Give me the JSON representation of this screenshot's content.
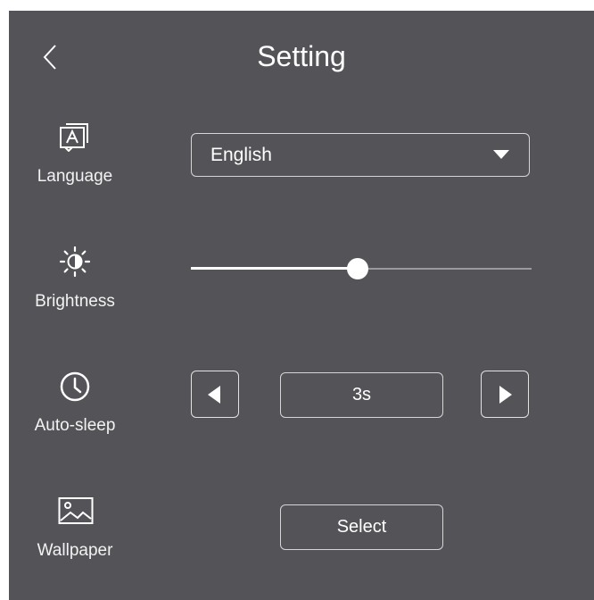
{
  "header": {
    "title": "Setting",
    "back_icon": "chevron-left-icon"
  },
  "settings": {
    "language": {
      "label": "Language",
      "icon": "language-icon",
      "value": "English"
    },
    "brightness": {
      "label": "Brightness",
      "icon": "brightness-icon",
      "level": 0.49
    },
    "auto_sleep": {
      "label": "Auto-sleep",
      "icon": "clock-icon",
      "value": "3s"
    },
    "wallpaper": {
      "label": "Wallpaper",
      "icon": "image-icon",
      "button_label": "Select"
    }
  },
  "colors": {
    "background": "#545458",
    "foreground": "#ffffff",
    "border": "#d6d6d6"
  }
}
